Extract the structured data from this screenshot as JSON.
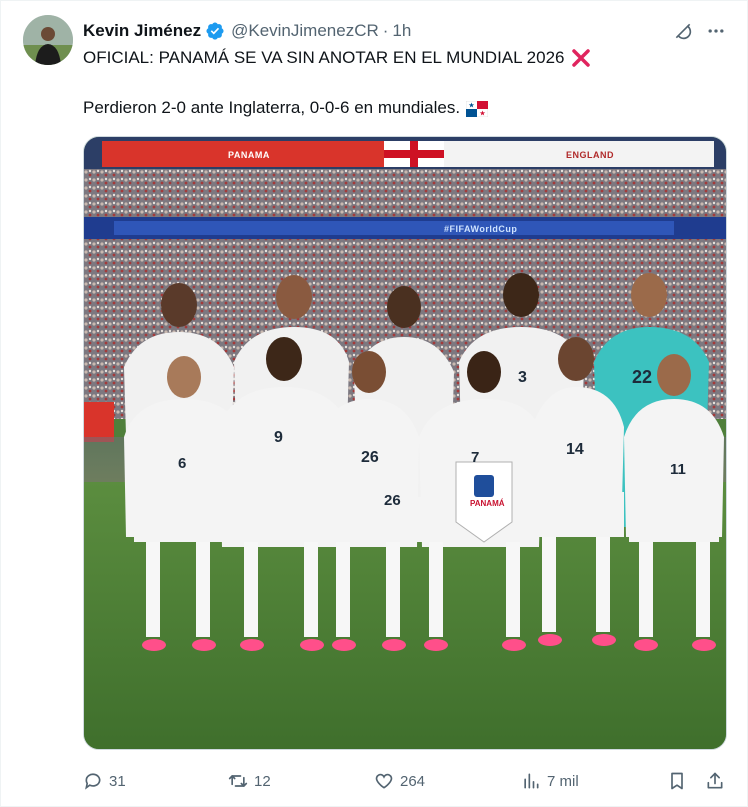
{
  "post": {
    "author_name": "Kevin Jiménez",
    "handle": "@KevinJimenezCR",
    "separator": "·",
    "time": "1h",
    "line1": "OFICIAL: PANAMÁ SE VA SIN ANOTAR EN EL MUNDIAL 2026",
    "line2": "Perdieron 2-0 ante Inglaterra, 0-0-6 en mundiales.",
    "emoji_after_line1": "cross-mark-icon",
    "emoji_after_line2": "panama-flag-icon"
  },
  "photo": {
    "banner_left": "PANAMA",
    "banner_right": "ENGLAND",
    "board_text": "#FIFAWorldCup",
    "pennant_title": "PANAMÁ",
    "jersey_numbers": [
      "6",
      "9",
      "26",
      "7",
      "14",
      "11",
      "3",
      "22",
      "26"
    ]
  },
  "actions": {
    "replies": "31",
    "reposts": "12",
    "likes": "264",
    "views": "7 mil"
  },
  "colors": {
    "verified": "#1d9bf0",
    "cross": "#e0245e",
    "secondary_text": "#536471",
    "pitch": "#4f7f3b"
  }
}
